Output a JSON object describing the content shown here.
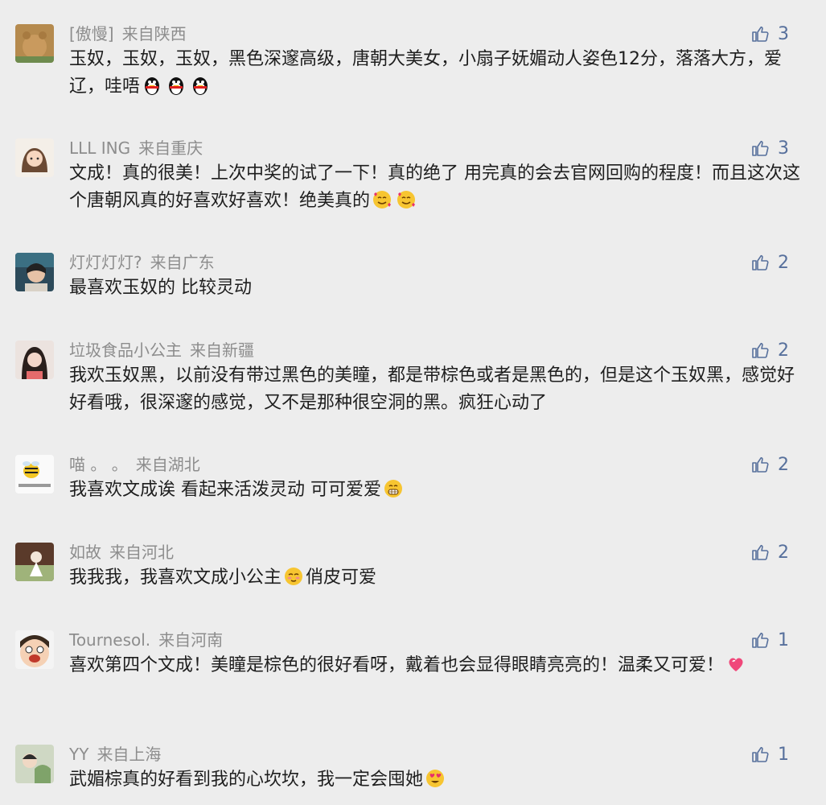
{
  "comments": [
    {
      "name": "[傲慢]",
      "location": "来自陕西",
      "likes": "3",
      "text": "玉奴，玉奴，玉奴，黑色深邃高级，唐朝大美女，小扇子妩媚动人姿色12分，落落大方，爱辽，哇唔",
      "emojis": [
        "penguin-emoji",
        "penguin-emoji",
        "penguin-emoji"
      ]
    },
    {
      "name": "LLL ING",
      "location": "来自重庆",
      "likes": "3",
      "text": "文成！真的很美！上次中奖的试了一下！真的绝了 用完真的会去官网回购的程度！而且这次这个唐朝风真的好喜欢好喜欢！绝美真的",
      "emojis": [
        "smiling-hearts-emoji",
        "smiling-hearts-emoji"
      ]
    },
    {
      "name": "灯灯灯灯?",
      "location": "来自广东",
      "likes": "2",
      "text": "最喜欢玉奴的 比较灵动",
      "emojis": []
    },
    {
      "name": "垃圾食品小公主",
      "location": "来自新疆",
      "likes": "2",
      "text": "我欢玉奴黑，以前没有带过黑色的美瞳，都是带棕色或者是黑色的，但是这个玉奴黑，感觉好好看哦，很深邃的感觉，又不是那种很空洞的黑。疯狂心动了",
      "emojis": []
    },
    {
      "name": "喵 。 。",
      "location": "来自湖北",
      "likes": "2",
      "text": "我喜欢文成诶 看起来活泼灵动 可可爱爱",
      "emojis": [
        "grin-emoji"
      ]
    },
    {
      "name": "如故",
      "location": "来自河北",
      "likes": "2",
      "text": "我我我，我喜欢文成小公主",
      "text2": "俏皮可爱",
      "emojis": [
        "smug-emoji"
      ]
    },
    {
      "name": "Tournesol.",
      "location": "来自河南",
      "likes": "1",
      "text": "喜欢第四个文成！美瞳是棕色的很好看呀，戴着也会显得眼睛亮亮的！温柔又可爱！",
      "emojis": [
        "heart-emoji"
      ]
    },
    {
      "name": "YY",
      "location": "来自上海",
      "likes": "1",
      "text": "武媚棕真的好看到我的心坎坎，我一定会囤她",
      "emojis": [
        "heart-eyes-emoji"
      ]
    }
  ]
}
